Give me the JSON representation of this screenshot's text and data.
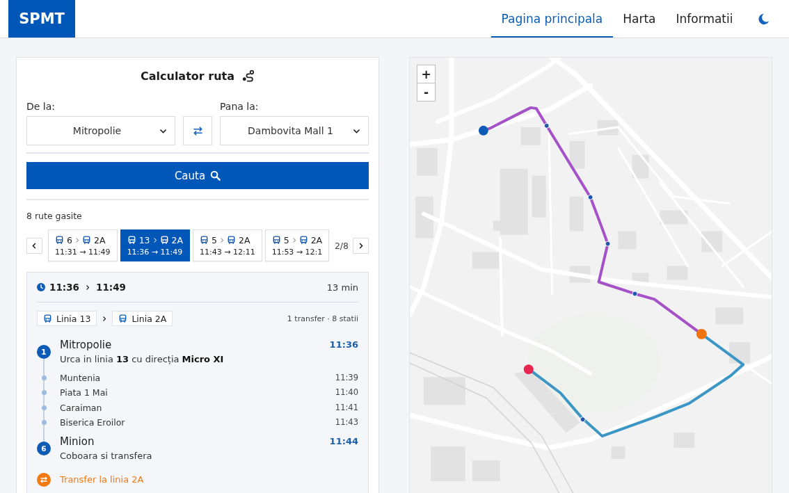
{
  "header": {
    "logo": "SPMT",
    "nav": [
      {
        "label": "Pagina principala",
        "selected": true
      },
      {
        "label": "Harta",
        "selected": false
      },
      {
        "label": "Informatii",
        "selected": false
      }
    ]
  },
  "planner": {
    "title": "Calculator ruta",
    "from": {
      "label": "De la:",
      "value": "Mitropolie"
    },
    "to": {
      "label": "Pana la:",
      "value": "Dambovita Mall 1"
    },
    "search_button": "Cauta",
    "results_count": "8 rute gasite",
    "routes": [
      {
        "legs": [
          "6",
          "2A"
        ],
        "times": "11:31 → 11:49",
        "selected": false
      },
      {
        "legs": [
          "13",
          "2A"
        ],
        "times": "11:36 → 11:49",
        "selected": true
      },
      {
        "legs": [
          "5",
          "2A"
        ],
        "times": "11:43 → 12:11",
        "selected": false
      },
      {
        "legs": [
          "5",
          "2A"
        ],
        "times": "11:53 → 12:1",
        "selected": false
      }
    ],
    "page": "2/8",
    "details": {
      "depart": "11:36",
      "arrive": "11:49",
      "duration": "13 min",
      "lines": [
        "Linia 13",
        "Linia 2A"
      ],
      "summary": "1 transfer · 8 statii",
      "steps": [
        {
          "kind": "stop",
          "badge": "1",
          "stop": "Mitropolie",
          "time": "11:36",
          "note": "Urca in linia **13** cu direcția **Micro XI**"
        },
        {
          "kind": "pass",
          "stop": "Muntenia",
          "time": "11:39"
        },
        {
          "kind": "pass",
          "stop": "Piata 1 Mai",
          "time": "11:40"
        },
        {
          "kind": "pass",
          "stop": "Caraiman",
          "time": "11:41"
        },
        {
          "kind": "pass",
          "stop": "Biserica Eroilor",
          "time": "11:43"
        },
        {
          "kind": "stop",
          "badge": "6",
          "stop": "Minion",
          "time": "11:44",
          "note": "Coboara si transfera"
        },
        {
          "kind": "transfer",
          "note": "Transfer la linia 2A"
        }
      ]
    }
  },
  "map": {
    "zoom_in": "+",
    "zoom_out": "-"
  }
}
